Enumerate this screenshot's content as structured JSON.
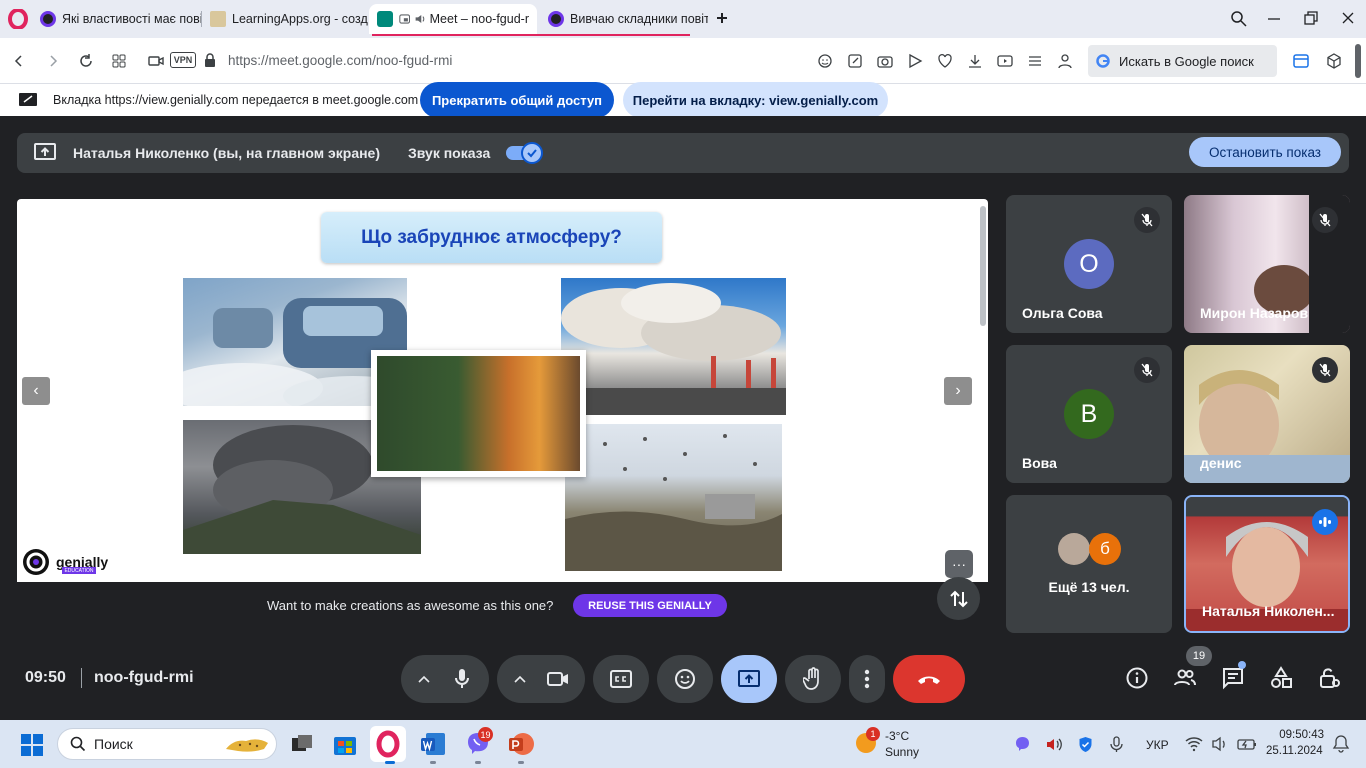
{
  "browser": {
    "tabs": [
      {
        "title": "Які властивості має повіт",
        "active": false
      },
      {
        "title": "LearningApps.org - созда",
        "active": false
      },
      {
        "title": "Meet – noo-fgud-r",
        "active": true
      },
      {
        "title": "Вивчаю складники повітр",
        "active": false
      }
    ],
    "url": "https://meet.google.com/noo-fgud-rmi",
    "vpn_label": "VPN",
    "search_placeholder": "Искать в Google поиск"
  },
  "share_banner": {
    "text": "Вкладка https://view.genially.com передается в meet.google.com",
    "stop_button": "Прекратить общий доступ",
    "goto_button": "Перейти на вкладку: view.genially.com"
  },
  "presentation_bar": {
    "presenter": "Наталья Николенко (вы, на главном экране)",
    "sound_label": "Звук показа",
    "stop_button": "Остановить показ"
  },
  "slide": {
    "title": "Що забруднює атмосферу?",
    "brand": "genially",
    "brand_sub": "EDUCATION",
    "promo_text": "Want to make creations as awesome as this one?",
    "reuse_button": "REUSE THIS GENIALLY",
    "prev_arrow": "‹",
    "next_arrow": "›",
    "more": "···"
  },
  "participants": [
    {
      "name": "Ольга Сова",
      "initial": "О",
      "avatar_color": "#5c6bc0",
      "muted": true
    },
    {
      "name": "Мирон Назаров",
      "video": true,
      "muted": true
    },
    {
      "name": "Вова",
      "initial": "В",
      "avatar_color": "#33691e",
      "muted": true
    },
    {
      "name": "денис",
      "video": true,
      "muted": true
    },
    {
      "name": "Наталья Николен...",
      "video": true,
      "speaking": true
    }
  ],
  "more_participants": {
    "label": "Ещё 13 чел.",
    "avatar_initial": "б"
  },
  "controls": {
    "time": "09:50",
    "meeting_code": "noo-fgud-rmi",
    "people_count": "19"
  },
  "taskbar": {
    "search": "Поиск",
    "viber_badge": "19",
    "weather_badge": "1",
    "temperature": "-3°C",
    "weather": "Sunny",
    "language": "УКР",
    "time": "09:50:43",
    "date": "25.11.2024"
  },
  "colors": {
    "meet_bg": "#202124",
    "tile_bg": "#3c4043",
    "accent_blue": "#a8c7fa",
    "hangup_red": "#dc362e",
    "genially_purple": "#6e36e8",
    "opera_red": "#e0245e"
  }
}
